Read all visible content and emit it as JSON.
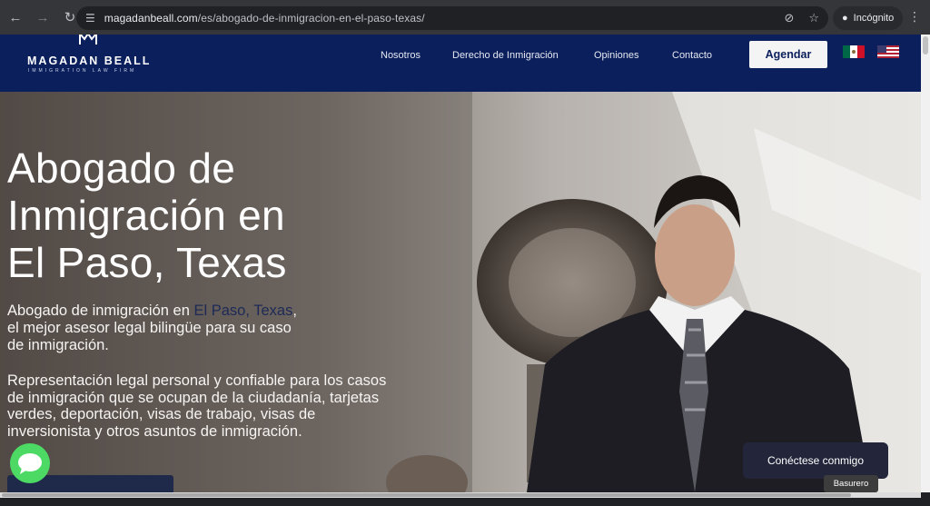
{
  "browser": {
    "url_host": "magadanbeall.com",
    "url_path": "/es/abogado-de-inmigracion-en-el-paso-texas/",
    "incognito_label": "Incógnito",
    "icons": [
      "back-arrow-icon",
      "forward-arrow-icon",
      "reload-icon",
      "site-info-icon",
      "eye-off-icon",
      "star-icon",
      "incognito-icon",
      "kebab-menu-icon"
    ]
  },
  "header": {
    "logo_name": "MAGADAN BEALL",
    "logo_sub": "IMMIGRATION LAW FIRM",
    "nav": [
      "Nosotros",
      "Derecho de Inmigración",
      "Opiniones",
      "Contacto"
    ],
    "cta_label": "Agendar",
    "flags": [
      "mexico-flag",
      "us-flag"
    ],
    "bg_color": "#0a1f5c"
  },
  "hero": {
    "title_line1": "Abogado de",
    "title_line2": "Inmigración en",
    "title_line3": "El Paso, Texas",
    "lead_prefix": "Abogado de inmigración en ",
    "lead_highlight": "El Paso, Texas",
    "lead_suffix": ",",
    "lead_line2": "el mejor asesor legal bilingüe para su caso",
    "lead_line3": "de inmigración.",
    "body": "Representación legal personal y confiable para los casos de inmigración que se ocupan de la ciudadanía, tarjetas verdes, deportación, visas de trabajo, visas de inversionista y otros asuntos de inmigración."
  },
  "widgets": {
    "connect_label": "Conéctese conmigo",
    "tooltip_label": "Basurero",
    "chat_color": "#4cd964"
  }
}
